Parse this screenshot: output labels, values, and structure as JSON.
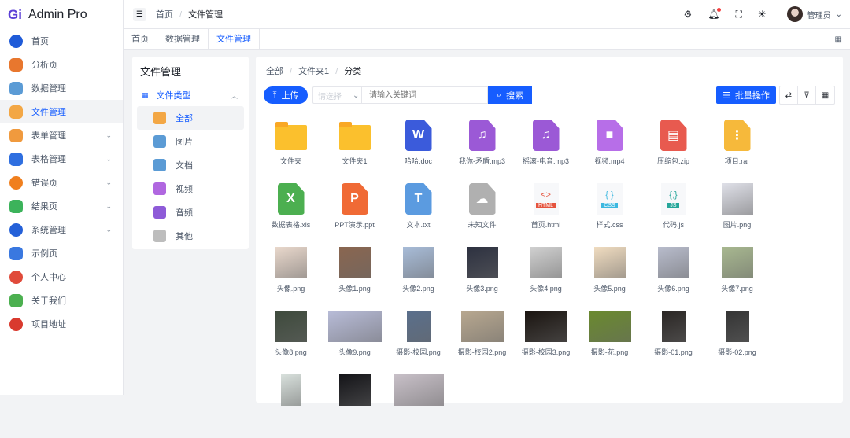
{
  "app": {
    "title": "Admin Pro",
    "logo": "Gi"
  },
  "sidebar": {
    "items": [
      {
        "label": "首页",
        "color": "#1f5bd8",
        "shape": "round"
      },
      {
        "label": "分析页",
        "color": "#e8772e"
      },
      {
        "label": "数据管理",
        "color": "#5b9bd5"
      },
      {
        "label": "文件管理",
        "color": "#f3a745",
        "active": true
      },
      {
        "label": "表单管理",
        "color": "#f09a3e",
        "chevron": true
      },
      {
        "label": "表格管理",
        "color": "#2f6fe0",
        "chevron": true
      },
      {
        "label": "错误页",
        "color": "#f07f1e",
        "shape": "round",
        "chevron": true
      },
      {
        "label": "结果页",
        "color": "#3cb35b",
        "chevron": true
      },
      {
        "label": "系统管理",
        "color": "#2460d8",
        "shape": "round",
        "chevron": true
      },
      {
        "label": "示例页",
        "color": "#3a78e0"
      },
      {
        "label": "个人中心",
        "color": "#e04a3a",
        "shape": "round"
      },
      {
        "label": "关于我们",
        "color": "#4cb050"
      },
      {
        "label": "项目地址",
        "color": "#d93a2e",
        "shape": "round"
      }
    ]
  },
  "header": {
    "breadcrumb": [
      "首页",
      "文件管理"
    ],
    "user": "管理员"
  },
  "tabs": [
    {
      "label": "首页"
    },
    {
      "label": "数据管理"
    },
    {
      "label": "文件管理",
      "active": true
    }
  ],
  "left_panel": {
    "title": "文件管理",
    "group": "文件类型",
    "items": [
      {
        "label": "全部",
        "color": "#f3a745",
        "active": true
      },
      {
        "label": "图片",
        "color": "#5b9bd5"
      },
      {
        "label": "文档",
        "color": "#5b9bd5"
      },
      {
        "label": "视频",
        "color": "#b067e0"
      },
      {
        "label": "音频",
        "color": "#8e5bd8"
      },
      {
        "label": "其他",
        "color": "#bdbdbd"
      }
    ]
  },
  "main": {
    "breadcrumb": [
      "全部",
      "文件夹1",
      "分类"
    ],
    "upload": "上传",
    "select_placeholder": "请选择",
    "search_placeholder": "请输入关键词",
    "search": "搜索",
    "batch": "批量操作"
  },
  "files": [
    {
      "name": "文件夹",
      "type": "folder"
    },
    {
      "name": "文件夹1",
      "type": "folder"
    },
    {
      "name": "哈哈.doc",
      "type": "doc",
      "glyph": "W",
      "color": "#3b5bdb"
    },
    {
      "name": "我你-矛盾.mp3",
      "type": "doc",
      "glyph": "♫",
      "color": "#9b59d6"
    },
    {
      "name": "摇滚-电音.mp3",
      "type": "doc",
      "glyph": "♫",
      "color": "#9b59d6"
    },
    {
      "name": "视频.mp4",
      "type": "doc",
      "glyph": "■",
      "color": "#b76ee8"
    },
    {
      "name": "压缩包.zip",
      "type": "doc",
      "glyph": "▤",
      "color": "#e85a4f"
    },
    {
      "name": "项目.rar",
      "type": "doc",
      "glyph": "⋮",
      "color": "#f6b93b"
    },
    {
      "name": "数据表格.xls",
      "type": "doc",
      "glyph": "X",
      "color": "#4caf50"
    },
    {
      "name": "PPT演示.ppt",
      "type": "doc",
      "glyph": "P",
      "color": "#f06a35"
    },
    {
      "name": "文本.txt",
      "type": "doc",
      "glyph": "T",
      "color": "#5b9be0"
    },
    {
      "name": "未知文件",
      "type": "doc",
      "glyph": "☁",
      "color": "#b0b0b0"
    },
    {
      "name": "首页.html",
      "type": "code",
      "glyph": "<>",
      "tag": "HTML",
      "color": "#e5533d"
    },
    {
      "name": "样式.css",
      "type": "code",
      "glyph": "{ }",
      "tag": "CSS",
      "color": "#3db8e0"
    },
    {
      "name": "代码.js",
      "type": "code",
      "glyph": "{;}",
      "tag": "JS",
      "color": "#26a69a"
    },
    {
      "name": "图片.png",
      "type": "thumb",
      "color": "#dfe0e8",
      "w": 40
    },
    {
      "name": "头像.png",
      "type": "thumb",
      "color": "#e9d8cc",
      "w": 40
    },
    {
      "name": "头像1.png",
      "type": "thumb",
      "color": "#8a6650",
      "w": 40
    },
    {
      "name": "头像2.png",
      "type": "thumb",
      "color": "#a8bcd8",
      "w": 40
    },
    {
      "name": "头像3.png",
      "type": "thumb",
      "color": "#2d3140",
      "w": 40
    },
    {
      "name": "头像4.png",
      "type": "thumb",
      "color": "#d0d0d0",
      "w": 40
    },
    {
      "name": "头像5.png",
      "type": "thumb",
      "color": "#f0dcc0",
      "w": 40
    },
    {
      "name": "头像6.png",
      "type": "thumb",
      "color": "#b8bccc",
      "w": 40
    },
    {
      "name": "头像7.png",
      "type": "thumb",
      "color": "#a8b890",
      "w": 40
    },
    {
      "name": "头像8.png",
      "type": "thumb",
      "color": "#3e4a3c",
      "w": 40
    },
    {
      "name": "头像9.png",
      "type": "thumb",
      "color": "#b8bcd8",
      "w": 68
    },
    {
      "name": "摄影-校园.png",
      "type": "thumb",
      "color": "#5a6f8c",
      "w": 30
    },
    {
      "name": "摄影-校园2.png",
      "type": "thumb",
      "color": "#b8a890",
      "w": 54
    },
    {
      "name": "摄影-校园3.png",
      "type": "thumb",
      "color": "#1a1410",
      "w": 54
    },
    {
      "name": "摄影-花.png",
      "type": "thumb",
      "color": "#6a8a2e",
      "w": 54
    },
    {
      "name": "摄影-01.png",
      "type": "thumb",
      "color": "#2a2624",
      "w": 30
    },
    {
      "name": "摄影-02.png",
      "type": "thumb",
      "color": "#343434",
      "w": 30
    },
    {
      "name": "",
      "type": "thumb",
      "color": "#d8e0dc",
      "w": 26
    },
    {
      "name": "",
      "type": "thumb",
      "color": "#141418",
      "w": 40
    },
    {
      "name": "",
      "type": "thumb",
      "color": "#c8c0c8",
      "w": 64
    }
  ]
}
